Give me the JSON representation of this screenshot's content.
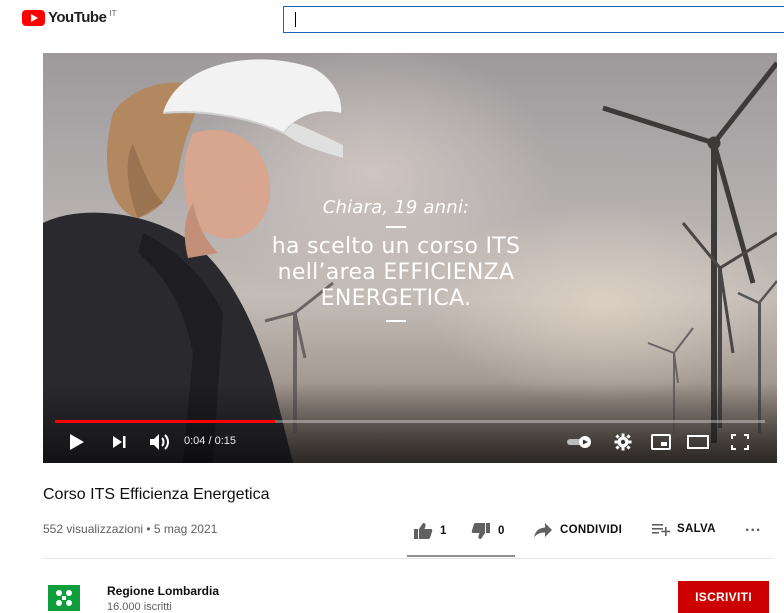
{
  "header": {
    "logo_text": "YouTube",
    "country_code": "IT",
    "search_value": ""
  },
  "video": {
    "overlay_line1": "Chiara, 19 anni:",
    "overlay_line2": "ha scelto un corso ITS",
    "overlay_line3": "nell’area EFFICIENZA",
    "overlay_line4": "ENERGETICA.",
    "time_display": "0:04 / 0:15",
    "progress_fraction": 0.31
  },
  "info": {
    "title": "Corso ITS Efficienza Energetica",
    "views_date": "552 visualizzazioni • 5 mag 2021",
    "like_count": "1",
    "dislike_count": "0",
    "share_label": "CONDIVIDI",
    "save_label": "SALVA",
    "more_label": "..."
  },
  "channel": {
    "name": "Regione Lombardia",
    "subscribers": "16.000 iscritti",
    "subscribe_label": "ISCRIVITI"
  },
  "colors": {
    "brand_red": "#ff0000",
    "subscribe_red": "#cc0000",
    "search_border": "#1c62b9",
    "channel_green": "#0e9f3c"
  }
}
